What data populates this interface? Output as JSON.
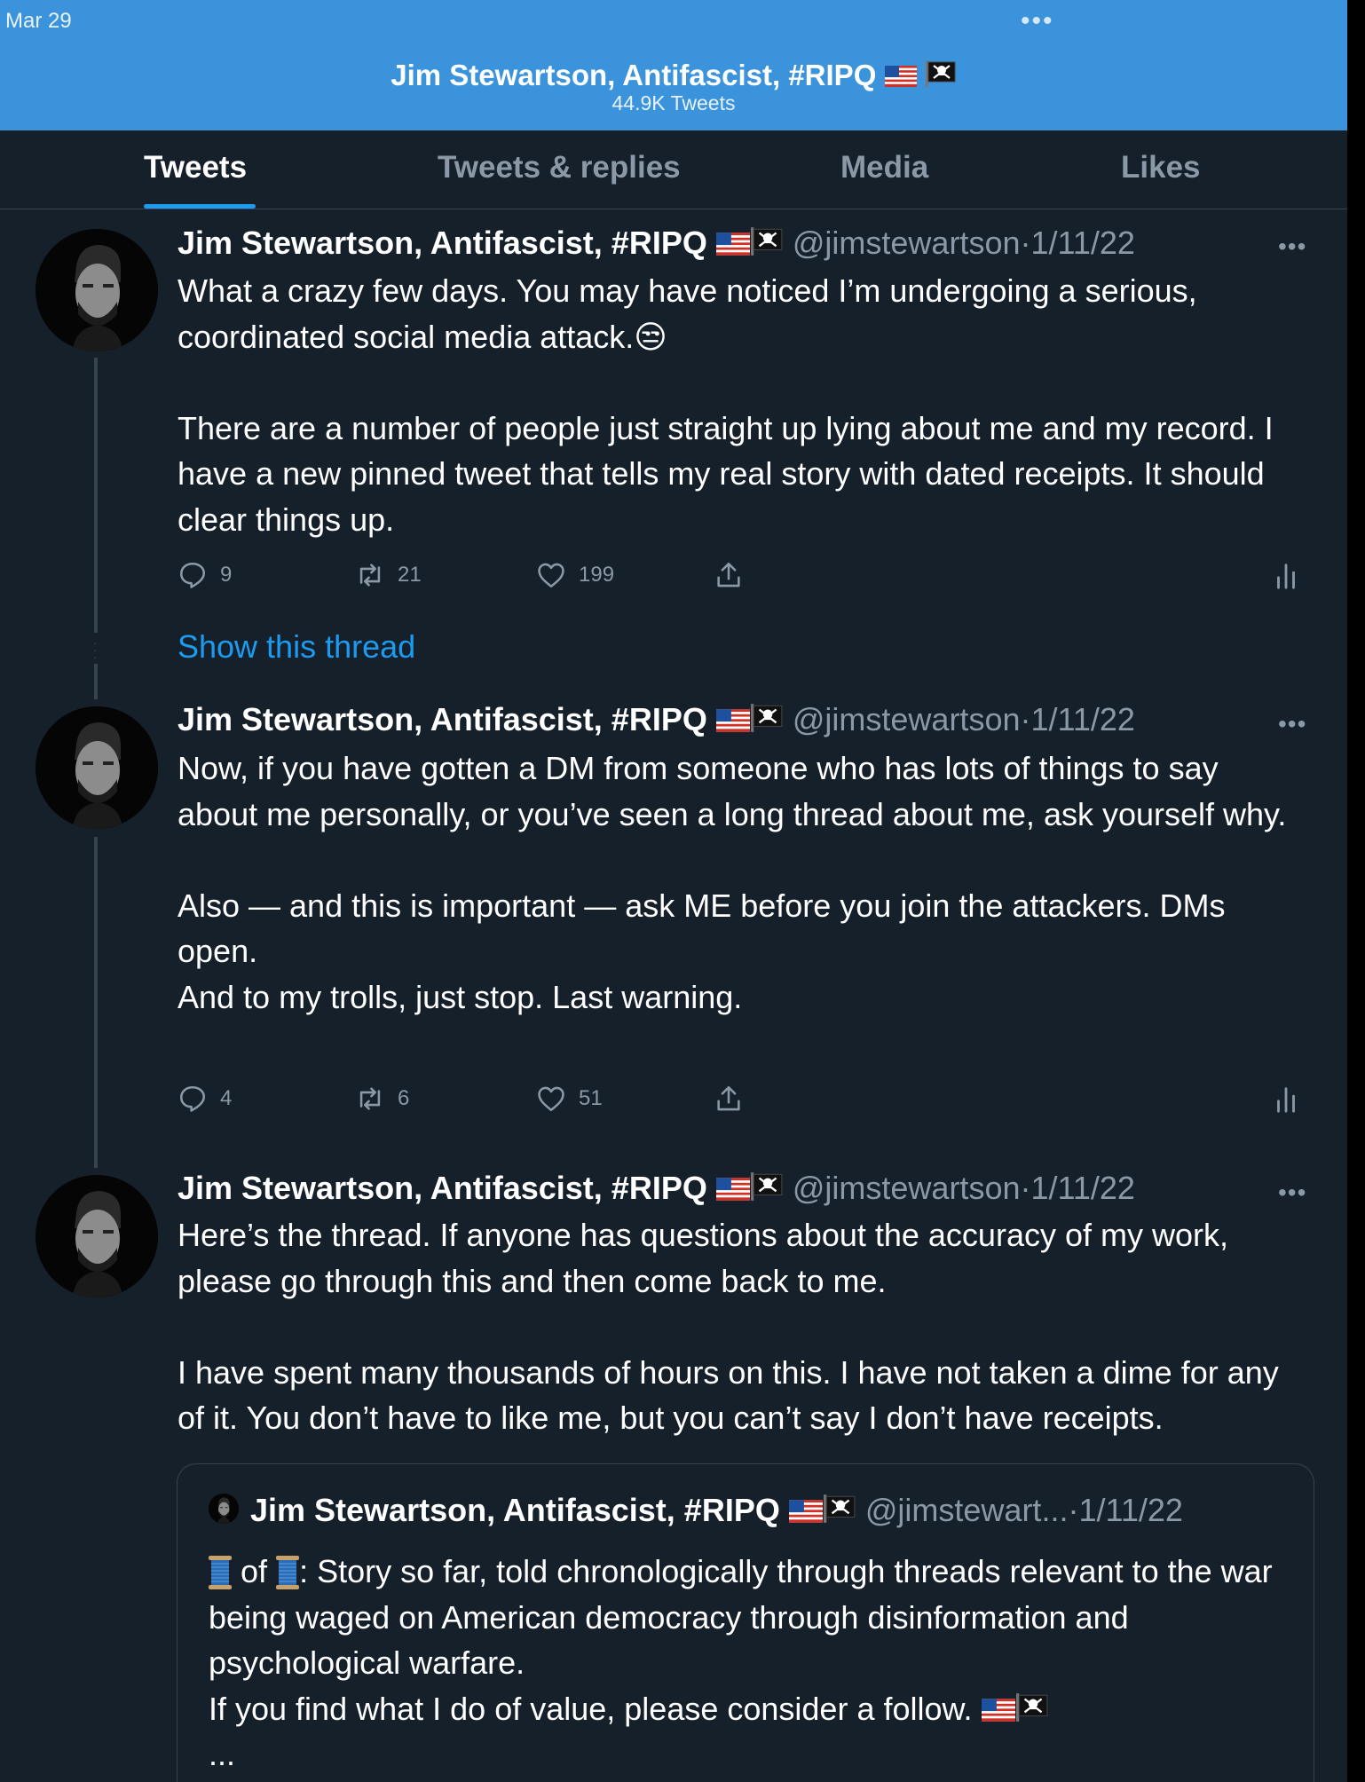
{
  "status": {
    "date": "Mar 29",
    "dots": "•••"
  },
  "header": {
    "title": "Jim Stewartson, Antifascist, #RIPQ",
    "subtitle": "44.9K Tweets"
  },
  "tabs": [
    {
      "label": "Tweets",
      "active": true
    },
    {
      "label": "Tweets & replies"
    },
    {
      "label": "Media"
    },
    {
      "label": "Likes"
    }
  ],
  "tweets": [
    {
      "name": "Jim Stewartson, Antifascist, #RIPQ",
      "handle": "@jimstewartson",
      "sep": "·",
      "date": "1/11/22",
      "lines": [
        "What a crazy few days. You may have noticed I’m undergoing a serious, coordinated social media attack.😒",
        "There are a number of people just straight up lying about me and my record. I have a new pinned tweet that tells my real story with dated receipts. It should clear things up."
      ],
      "replies": "9",
      "retweets": "21",
      "likes": "199"
    },
    {
      "name": "Jim Stewartson, Antifascist, #RIPQ",
      "handle": "@jimstewartson",
      "sep": "·",
      "date": "1/11/22",
      "lines": [
        "Now, if you have gotten a DM from someone who has lots of things to say about me personally, or you’ve seen a long thread about me, ask yourself why.",
        "Also — and this is important — ask ME before you join the attackers. DMs open.",
        "And to my trolls, just stop. Last warning."
      ],
      "replies": "4",
      "retweets": "6",
      "likes": "51"
    },
    {
      "name": "Jim Stewartson, Antifascist, #RIPQ",
      "handle": "@jimstewartson",
      "sep": "·",
      "date": "1/11/22",
      "lines": [
        "Here’s the thread. If anyone has questions about the accuracy of my work, please go through this and then come back to me.",
        "I have spent many thousands of hours on this. I have not taken a dime for any of it. You don’t have to like me, but you can’t say I don’t have receipts."
      ]
    }
  ],
  "show_thread": "Show this thread",
  "quote": {
    "name": "Jim Stewartson, Antifascist, #RIPQ",
    "handle": "@jimstewart...",
    "sep": "·",
    "date": "1/11/22",
    "line1_of": "of",
    "line1_rest": ": Story so far, told chronologically through threads relevant to the war being waged on American democracy through disinformation and psychological warfare.",
    "line2": "If you find what I do of value, please consider a follow.",
    "ellipsis": "..."
  },
  "icons": {
    "more": "more-horizontal-icon",
    "reply": "reply-icon",
    "retweet": "retweet-icon",
    "like": "heart-icon",
    "share": "share-icon",
    "analytics": "analytics-icon"
  },
  "colors": {
    "accent": "#1d9bf0",
    "header": "#3b93dc",
    "background": "#15202b",
    "muted": "#8b98a5"
  }
}
